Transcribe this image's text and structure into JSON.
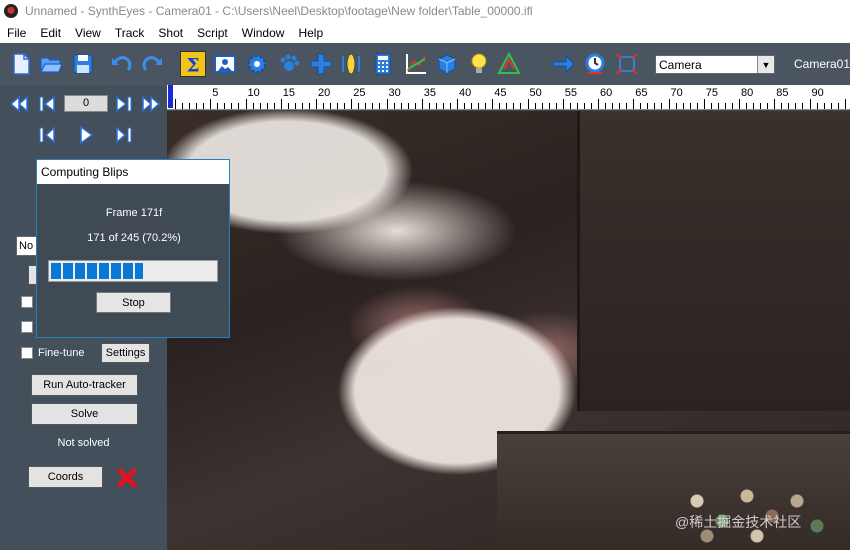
{
  "window": {
    "title": "Unnamed - SynthEyes - Camera01 - C:\\Users\\Neel\\Desktop\\footage\\New folder\\Table_00000.ifl"
  },
  "menu": [
    "File",
    "Edit",
    "View",
    "Track",
    "Shot",
    "Script",
    "Window",
    "Help"
  ],
  "toolbar": {
    "icons": [
      "new-file-icon",
      "open-folder-icon",
      "save-icon",
      "undo-icon",
      "redo-icon",
      "sigma-icon",
      "image-icon",
      "gear-icon",
      "paw-icon",
      "cross-move-icon",
      "lens-icon",
      "calculator-icon",
      "graph-icon",
      "cube-icon",
      "lightbulb-icon",
      "triangle-icon",
      "arrow-right-icon",
      "clock-icon",
      "crop-icon"
    ],
    "camera_select": "Camera",
    "camera_label": "Camera01"
  },
  "playback": {
    "frame": "0"
  },
  "timeline": {
    "labels": [
      "5",
      "10",
      "15",
      "20",
      "25",
      "30",
      "35",
      "40",
      "45",
      "50",
      "55",
      "60",
      "65",
      "70",
      "75",
      "80",
      "85",
      "90"
    ]
  },
  "dialog": {
    "title": "Computing Blips",
    "frame_text": "Frame 171f",
    "count_text": "171 of 245 (70.2%)",
    "progress_percent": 70.2,
    "stop_label": "Stop"
  },
  "left": {
    "mode_select": "No",
    "finetune_label": "Fine-tune",
    "settings_label": "Settings",
    "run_autotracker_label": "Run Auto-tracker",
    "solve_label": "Solve",
    "status_text": "Not solved",
    "coords_label": "Coords"
  },
  "watermark": "@稀土掘金技术社区"
}
